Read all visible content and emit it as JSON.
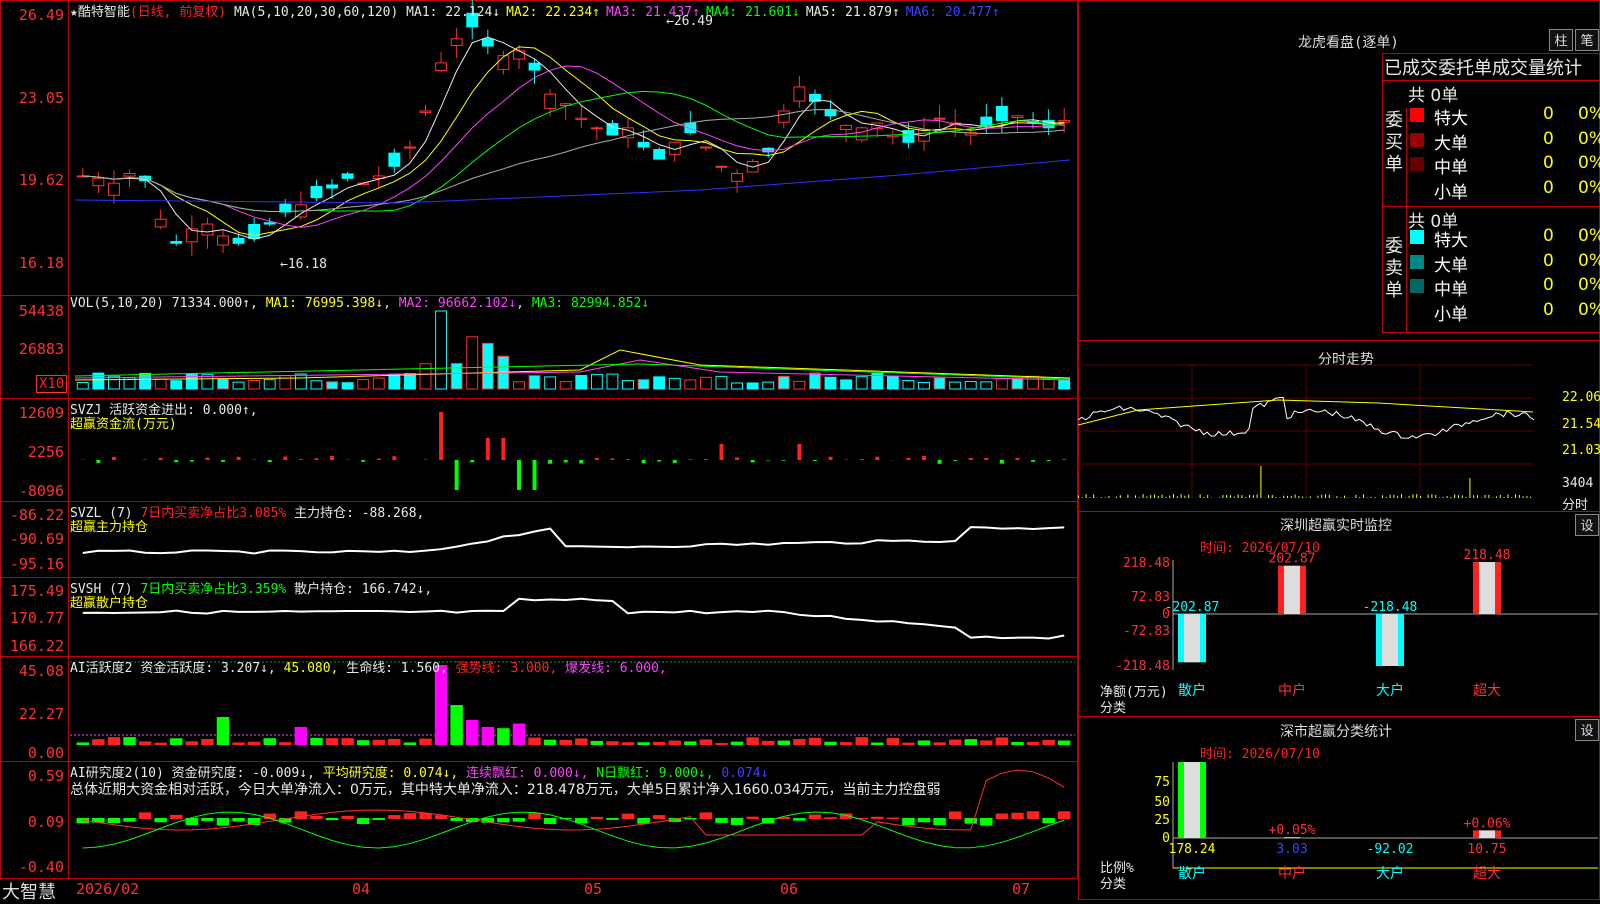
{
  "kline": {
    "title": "★酷特智能",
    "adj": "(日线, 前复权)",
    "ma_label": "MA(5,10,20,30,60,120)",
    "ma": [
      {
        "k": "MA1: 22.124↓",
        "c": "#e8e8e8"
      },
      {
        "k": "MA2: 22.234↑",
        "c": "#ffff00"
      },
      {
        "k": "MA3: 21.437↑",
        "c": "#ff40ff"
      },
      {
        "k": "MA4: 21.601↓",
        "c": "#00ff00"
      },
      {
        "k": "MA5: 21.879↑",
        "c": "#e8e8e8"
      },
      {
        "k": "MA6: 20.477↑",
        "c": "#4040ff"
      }
    ],
    "yticks": [
      "26.49",
      "23.05",
      "19.62",
      "16.18"
    ],
    "high_note": "←26.49",
    "low_note": "←16.18"
  },
  "vol": {
    "label": "VOL(5,10,20)",
    "val": "71334.000↑",
    "ma": [
      "MA1: 76995.398↓",
      "MA2: 96662.102↓",
      "MA3: 82994.852↓"
    ],
    "yticks": [
      "54438",
      "26883"
    ],
    "unit": "X10"
  },
  "svzj": {
    "line1": "SVZJ  活跃资金进出: 0.000↑,",
    "line2": "超赢资金流(万元)",
    "yticks": [
      "12609",
      "2256",
      "-8096"
    ]
  },
  "svzl": {
    "label": "SVZL (7)",
    "ratio": "7日内买卖净占比3.085%",
    "hold": "主力持仓: -88.268,",
    "line2": "超赢主力持仓",
    "yticks": [
      "-86.22",
      "-90.69",
      "-95.16"
    ]
  },
  "svsh": {
    "label": "SVSH (7)",
    "ratio": "7日内买卖净占比3.359%",
    "hold": "散户持仓: 166.742↓,",
    "line2": "超赢散户持仓",
    "yticks": [
      "175.49",
      "170.77",
      "166.22"
    ]
  },
  "ai1": {
    "label": "AI活跃度2",
    "a": "资金活跃度: 3.207↓,",
    "b": "45.080,",
    "c": "生命线: 1.560,",
    "d": "强势线: 3.000,",
    "e": "爆发线: 6.000,",
    "yticks": [
      "45.08",
      "22.27",
      "0.00"
    ]
  },
  "ai2": {
    "label": "AI研究度2(10)",
    "a": "资金研究度: -0.009↓,",
    "b": "平均研究度: 0.074↓,",
    "c": "连续飘红: 0.000↓,",
    "d": "N日飘红: 9.000↓,",
    "e": "0.074↓",
    "summary": "总体近期大资金相对活跃，今日大单净流入：0万元，其中特大单净流入：218.478万元，大单5日累计净入1660.034万元，当前主力控盘弱",
    "yticks": [
      "0.59",
      "0.09",
      "-0.40"
    ]
  },
  "xaxis": {
    "brand": "大智慧",
    "labels": [
      "2026/02",
      "04",
      "05",
      "06",
      "07"
    ]
  },
  "lhb": {
    "title": "龙虎看盘(逐单)",
    "btn_zhu": "柱",
    "btn_bi": "笔",
    "tabs": "已成交委托单成交量统计",
    "buy_label": "委买单",
    "sell_label": "委卖单",
    "buy_total": "共 0单",
    "sell_total": "共 0单",
    "buy_rows": [
      {
        "name": "特大",
        "count": "0",
        "pct": "0%",
        "color": "#ff0000"
      },
      {
        "name": "大单",
        "count": "0",
        "pct": "0%",
        "color": "#990000"
      },
      {
        "name": "中单",
        "count": "0",
        "pct": "0%",
        "color": "#660000"
      },
      {
        "name": "小单",
        "count": "0",
        "pct": "0%",
        "color": "#000000"
      }
    ],
    "sell_rows": [
      {
        "name": "特大",
        "count": "0",
        "pct": "0%",
        "color": "#00ffff"
      },
      {
        "name": "大单",
        "count": "0",
        "pct": "0%",
        "color": "#008888"
      },
      {
        "name": "中单",
        "count": "0",
        "pct": "0%",
        "color": "#006666"
      },
      {
        "name": "小单",
        "count": "0",
        "pct": "0%",
        "color": "#000000"
      }
    ]
  },
  "intraday": {
    "title": "分时走势",
    "yticks": [
      "22.06",
      "21.54",
      "21.03"
    ],
    "vol_tick": "3404",
    "vol_unit": "分时"
  },
  "sz_monitor": {
    "title": "深圳超赢实时监控",
    "btn": "设",
    "time": "时间: 2026/07/10",
    "yticks": [
      "218.48",
      "72.83",
      "0",
      "-72.83",
      "-218.48"
    ],
    "ylabel": "净额(万元)",
    "xlabel": "分类",
    "bars": [
      {
        "cat": "散户",
        "val": -202.87,
        "label": "-202.87"
      },
      {
        "cat": "中户",
        "val": 202.87,
        "label": "202.87"
      },
      {
        "cat": "大户",
        "val": -218.48,
        "label": "-218.48"
      },
      {
        "cat": "超大",
        "val": 218.48,
        "label": "218.48"
      }
    ]
  },
  "sz_class": {
    "title": "深市超赢分类统计",
    "btn": "设",
    "time": "时间: 2026/07/10",
    "yticks": [
      "75",
      "50",
      "25",
      "0"
    ],
    "ylabel": "比例%",
    "xlabel": "分类",
    "bars": [
      {
        "cat": "散户",
        "value": "178.24",
        "pct": "",
        "ratio": 100
      },
      {
        "cat": "中户",
        "value": "3.03",
        "pct": "+0.05%",
        "ratio": 1
      },
      {
        "cat": "大户",
        "value": "-92.02",
        "pct": "",
        "ratio": 0
      },
      {
        "cat": "超大",
        "value": "10.75",
        "pct": "+0.06%",
        "ratio": 10
      }
    ]
  }
}
